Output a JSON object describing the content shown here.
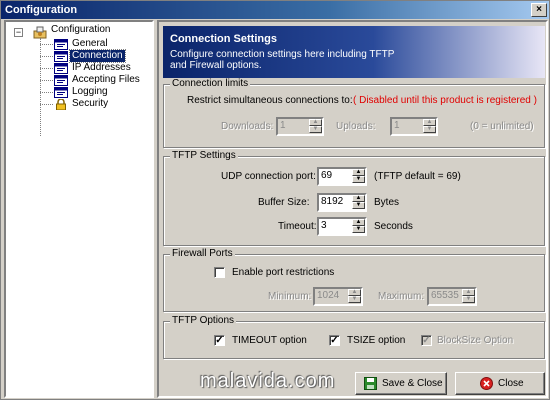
{
  "window": {
    "title": "Configuration",
    "close_glyph": "×"
  },
  "tree": {
    "root": {
      "label": "Configuration",
      "expander": "−",
      "icon": "configuration-icon"
    },
    "items": [
      {
        "label": "General",
        "icon": "config-page-icon",
        "selected": false
      },
      {
        "label": "Connection",
        "icon": "config-page-icon",
        "selected": true
      },
      {
        "label": "IP Addresses",
        "icon": "config-page-icon",
        "selected": false
      },
      {
        "label": "Accepting Files",
        "icon": "config-page-icon",
        "selected": false
      },
      {
        "label": "Logging",
        "icon": "config-page-icon",
        "selected": false
      },
      {
        "label": "Security",
        "icon": "lock-icon",
        "selected": false
      }
    ]
  },
  "banner": {
    "title": "Connection Settings",
    "description": "Configure connection settings here including TFTP and Firewall options."
  },
  "connection_limits": {
    "legend": "Connection limits",
    "restrict_label": "Restrict simultaneous connections to:",
    "restrict_note": "( Disabled until this product is registered )",
    "downloads_label": "Downloads:",
    "downloads_value": "1",
    "uploads_label": "Uploads:",
    "uploads_value": "1",
    "unlimited_note": "(0 = unlimited)"
  },
  "tftp_settings": {
    "legend": "TFTP Settings",
    "udp_port_label": "UDP connection port:",
    "udp_port_value": "69",
    "udp_port_note": "(TFTP default = 69)",
    "buffer_label": "Buffer Size:",
    "buffer_value": "8192",
    "buffer_unit": "Bytes",
    "timeout_label": "Timeout:",
    "timeout_value": "3",
    "timeout_unit": "Seconds"
  },
  "firewall_ports": {
    "legend": "Firewall Ports",
    "enable_label": "Enable port restrictions",
    "enable_checked": false,
    "minimum_label": "Minimum:",
    "minimum_value": "1024",
    "maximum_label": "Maximum:",
    "maximum_value": "65535"
  },
  "tftp_options": {
    "legend": "TFTP Options",
    "timeout_option_label": "TIMEOUT option",
    "timeout_option_checked": true,
    "tsize_option_label": "TSIZE option",
    "tsize_option_checked": true,
    "blocksize_option_label": "BlockSize Option",
    "blocksize_option_checked": true,
    "check_glyph": "✓"
  },
  "buttons": {
    "save_close_label": "Save & Close",
    "close_label": "Close"
  },
  "spin_glyphs": {
    "up": "▲",
    "down": "▼"
  },
  "watermark": "malavida.com",
  "colors": {
    "title_bar": "#0a246a",
    "selection": "#0a246a",
    "warning_text": "#e00000",
    "face": "#d4d0c8"
  }
}
